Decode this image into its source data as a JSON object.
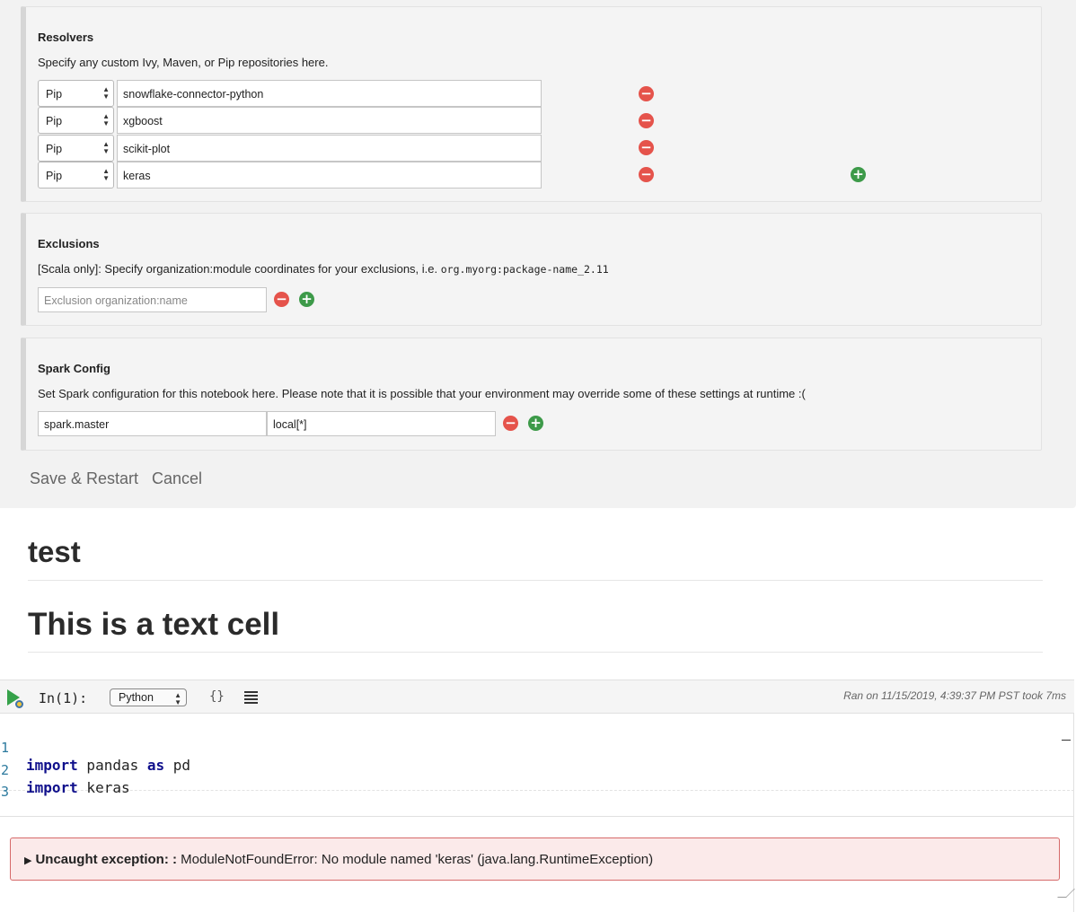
{
  "resolvers": {
    "title": "Resolvers",
    "description": "Specify any custom Ivy, Maven, or Pip repositories here.",
    "rows": [
      {
        "type": "Pip",
        "value": "snowflake-connector-python"
      },
      {
        "type": "Pip",
        "value": "xgboost"
      },
      {
        "type": "Pip",
        "value": "scikit-plot"
      },
      {
        "type": "Pip",
        "value": "keras"
      }
    ]
  },
  "exclusions": {
    "title": "Exclusions",
    "description": "[Scala only]: Specify organization:module coordinates for your exclusions, i.e. ",
    "description_code": "org.myorg:package-name_2.11",
    "placeholder": "Exclusion organization:name"
  },
  "spark_config": {
    "title": "Spark Config",
    "description": "Set Spark configuration for this notebook here. Please note that it is possible that your environment may override some of these settings at runtime :(",
    "key": "spark.master",
    "value": "local[*]"
  },
  "actions": {
    "save_label": "Save & Restart",
    "cancel_label": "Cancel"
  },
  "notebook": {
    "heading_1": "test",
    "heading_2": "This is a text cell",
    "cell": {
      "label": "In(1):",
      "language": "Python",
      "braces_glyph": "{}",
      "ran_info": "Ran on 11/15/2019, 4:39:37 PM PST took 7ms",
      "lines": [
        {
          "num": "1",
          "kw1": "import",
          "mid": " pandas ",
          "kw2": "as",
          "end": " pd"
        },
        {
          "num": "2",
          "kw1": "import",
          "mid": " keras",
          "kw2": "",
          "end": ""
        },
        {
          "num": "3",
          "kw1": "",
          "mid": "",
          "kw2": "",
          "end": ""
        }
      ]
    },
    "error": {
      "arrow": "▶",
      "label": "Uncaught exception: :",
      "message": " ModuleNotFoundError: No module named 'keras' (java.lang.RuntimeException)"
    }
  },
  "colors": {
    "remove": "#e5534b",
    "add": "#3d9a49",
    "run": "#36a24a",
    "error_bg": "#fbeaea",
    "error_border": "#d66a6a",
    "keyword": "#10108c"
  },
  "icons": {
    "remove": "minus-circle-icon",
    "add": "plus-circle-icon",
    "run": "play-icon",
    "braces": "braces-icon",
    "list": "list-icon"
  }
}
